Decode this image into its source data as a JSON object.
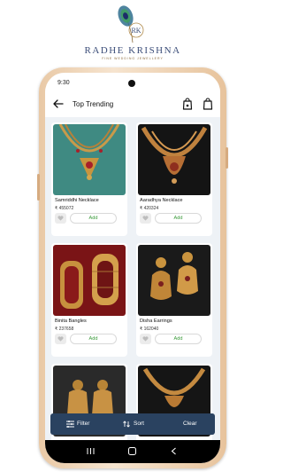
{
  "brand": {
    "name": "RADHE KRISHNA",
    "tagline": "Fine Wedding Jewellery"
  },
  "status_bar": {
    "time": "9:30"
  },
  "app_bar": {
    "title": "Top Trending",
    "icons": [
      "back-arrow-icon",
      "shopping-bag-icon",
      "shopping-bag-icon"
    ]
  },
  "products": [
    {
      "name": "Samriddhi Necklace",
      "price": "₹ 455072",
      "add_label": "Add"
    },
    {
      "name": "Aaradhya Necklace",
      "price": "₹ 420324",
      "add_label": "Add"
    },
    {
      "name": "Binita Bangles",
      "price": "₹ 237658",
      "add_label": "Add"
    },
    {
      "name": "Disha Earrings",
      "price": "₹ 162040",
      "add_label": "Add"
    },
    {
      "name": "",
      "price": "",
      "add_label": ""
    },
    {
      "name": "",
      "price": "",
      "add_label": ""
    }
  ],
  "filter_bar": {
    "filter_label": "Filter",
    "sort_label": "Sort",
    "clear_label": "Clear"
  },
  "colors": {
    "accent": "#3a9a3a",
    "filter_bar": "#2a4260",
    "phone_frame": "#f0d4b4",
    "brand_text": "#3d4f7a"
  }
}
